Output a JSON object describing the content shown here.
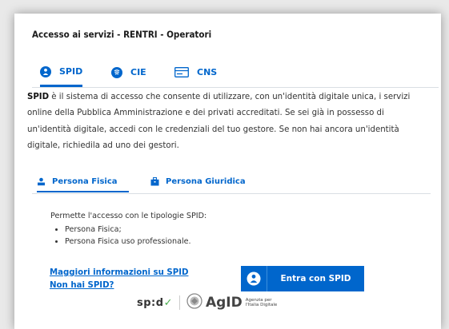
{
  "title": "Accesso ai servizi - RENTRI - Operatori",
  "tabs": [
    {
      "label": "SPID",
      "icon": "spid-icon"
    },
    {
      "label": "CIE",
      "icon": "cie-icon"
    },
    {
      "label": "CNS",
      "icon": "card-icon"
    }
  ],
  "description": {
    "bold": "SPID",
    "text": " è il sistema di accesso che consente di utilizzare, con un'identità digitale unica, i servizi online della Pubblica Amministrazione e dei privati accreditati. Se sei già in possesso di un'identità digitale, accedi con le credenziali del tuo gestore. Se non hai ancora un'identità digitale, richiedila ad uno dei gestori."
  },
  "subtabs": [
    {
      "label": "Persona Fisica",
      "icon": "person-icon"
    },
    {
      "label": "Persona Giuridica",
      "icon": "briefcase-icon"
    }
  ],
  "permissions": {
    "intro": "Permette l'accesso con le tipologie SPID:",
    "items": [
      "Persona Fisica;",
      "Persona Fisica uso professionale."
    ]
  },
  "links": {
    "more_info": "Maggiori informazioni su SPID",
    "no_spid": "Non hai SPID?"
  },
  "spid_button": {
    "label": "Entra con SPID"
  },
  "logos": {
    "spid": "sp:d",
    "agid": "AgID",
    "agid_sub1": "Agenzia per",
    "agid_sub2": "l'Italia Digitale"
  },
  "colors": {
    "accent": "#0066cc",
    "text": "#333333"
  }
}
